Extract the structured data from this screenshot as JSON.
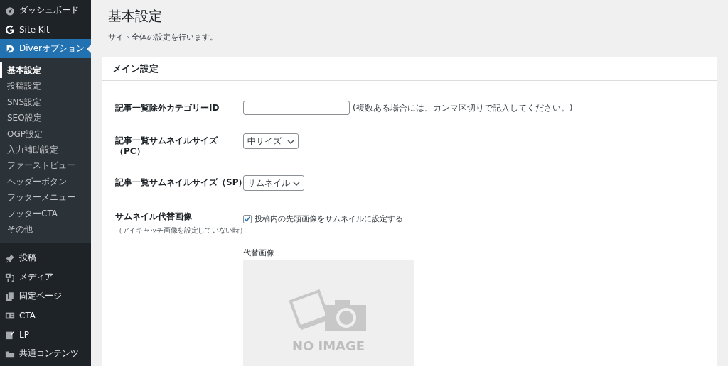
{
  "sidebar": {
    "menu": [
      {
        "label": "ダッシュボード",
        "selected": false
      },
      {
        "label": "Site Kit",
        "selected": false
      },
      {
        "label": "Diverオプション",
        "selected": true,
        "submenu": [
          {
            "label": "基本設定",
            "selected": true
          },
          {
            "label": "投稿設定",
            "selected": false
          },
          {
            "label": "SNS設定",
            "selected": false
          },
          {
            "label": "SEO設定",
            "selected": false
          },
          {
            "label": "OGP設定",
            "selected": false
          },
          {
            "label": "入力補助設定",
            "selected": false
          },
          {
            "label": "ファーストビュー",
            "selected": false
          },
          {
            "label": "ヘッダーボタン",
            "selected": false
          },
          {
            "label": "フッターメニュー",
            "selected": false
          },
          {
            "label": "フッターCTA",
            "selected": false
          },
          {
            "label": "その他",
            "selected": false
          }
        ]
      },
      {
        "label": "投稿",
        "selected": false
      },
      {
        "label": "メディア",
        "selected": false
      },
      {
        "label": "固定ページ",
        "selected": false
      },
      {
        "label": "CTA",
        "selected": false
      },
      {
        "label": "LP",
        "selected": false
      },
      {
        "label": "共通コンテンツ",
        "selected": false
      }
    ]
  },
  "page": {
    "title": "基本設定",
    "description": "サイト全体の設定を行います。"
  },
  "panel": {
    "title": "メイン設定",
    "rows": [
      {
        "kind": "text",
        "label": "記事一覧除外カテゴリーID",
        "note": "(複数ある場合には、カンマ区切りで記入してください。)"
      },
      {
        "kind": "select",
        "label": "記事一覧サムネイルサイズ",
        "label_line2": "（PC）",
        "value": "中サイズ"
      },
      {
        "kind": "select",
        "label": "記事一覧サムネイルサイズ（SP）",
        "value": "サムネイル"
      },
      {
        "kind": "checkbox",
        "label": "サムネイル代替画像",
        "sublabel": "（アイキャッチ画像を設定していない時）",
        "checked": true,
        "option": "投稿内の先頭画像をサムネイルに設定する",
        "image_label": "代替画像",
        "image_text": "NO IMAGE"
      }
    ]
  }
}
